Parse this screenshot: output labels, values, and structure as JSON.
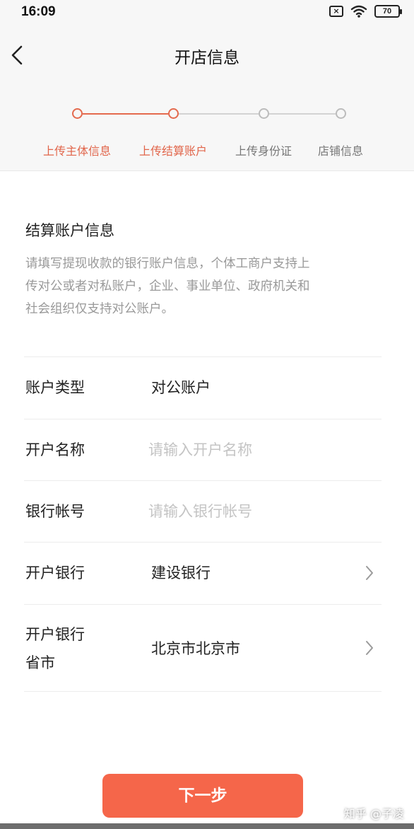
{
  "status_bar": {
    "time": "16:09",
    "sim_label": "×",
    "battery_level": "70",
    "icons": [
      "sim-x-icon",
      "wifi-icon",
      "battery-icon"
    ]
  },
  "nav": {
    "title": "开店信息",
    "back_icon": "chevron-left-icon"
  },
  "stepper": {
    "accent_color": "#e1654a",
    "current_step": 2,
    "steps": [
      {
        "label": "上传主体信息",
        "active": true
      },
      {
        "label": "上传结算账户",
        "active": true
      },
      {
        "label": "上传身份证",
        "active": false
      },
      {
        "label": "店铺信息",
        "active": false
      }
    ]
  },
  "section": {
    "title": "结算账户信息",
    "description_lines": [
      "请填写提现收款的银行账户信息，个体工商户支持上",
      "传对公或者对私账户，企业、事业单位、政府机关和",
      "社会组织仅支持对公账户。"
    ]
  },
  "form": {
    "account_type": {
      "label": "账户类型",
      "value": "对公账户"
    },
    "account_name": {
      "label": "开户名称",
      "value": "",
      "placeholder": "请输入开户名称"
    },
    "bank_account": {
      "label": "银行帐号",
      "value": "",
      "placeholder": "请输入银行帐号"
    },
    "bank": {
      "label": "开户银行",
      "value": "建设银行",
      "icon": "chevron-right-icon"
    },
    "bank_region": {
      "label_line1": "开户银行",
      "label_line2": "省市",
      "value": "北京市北京市",
      "icon": "chevron-right-icon"
    }
  },
  "next_button": {
    "label": "下一步",
    "color": "#f5664a"
  },
  "watermark": "知乎 @子凌"
}
